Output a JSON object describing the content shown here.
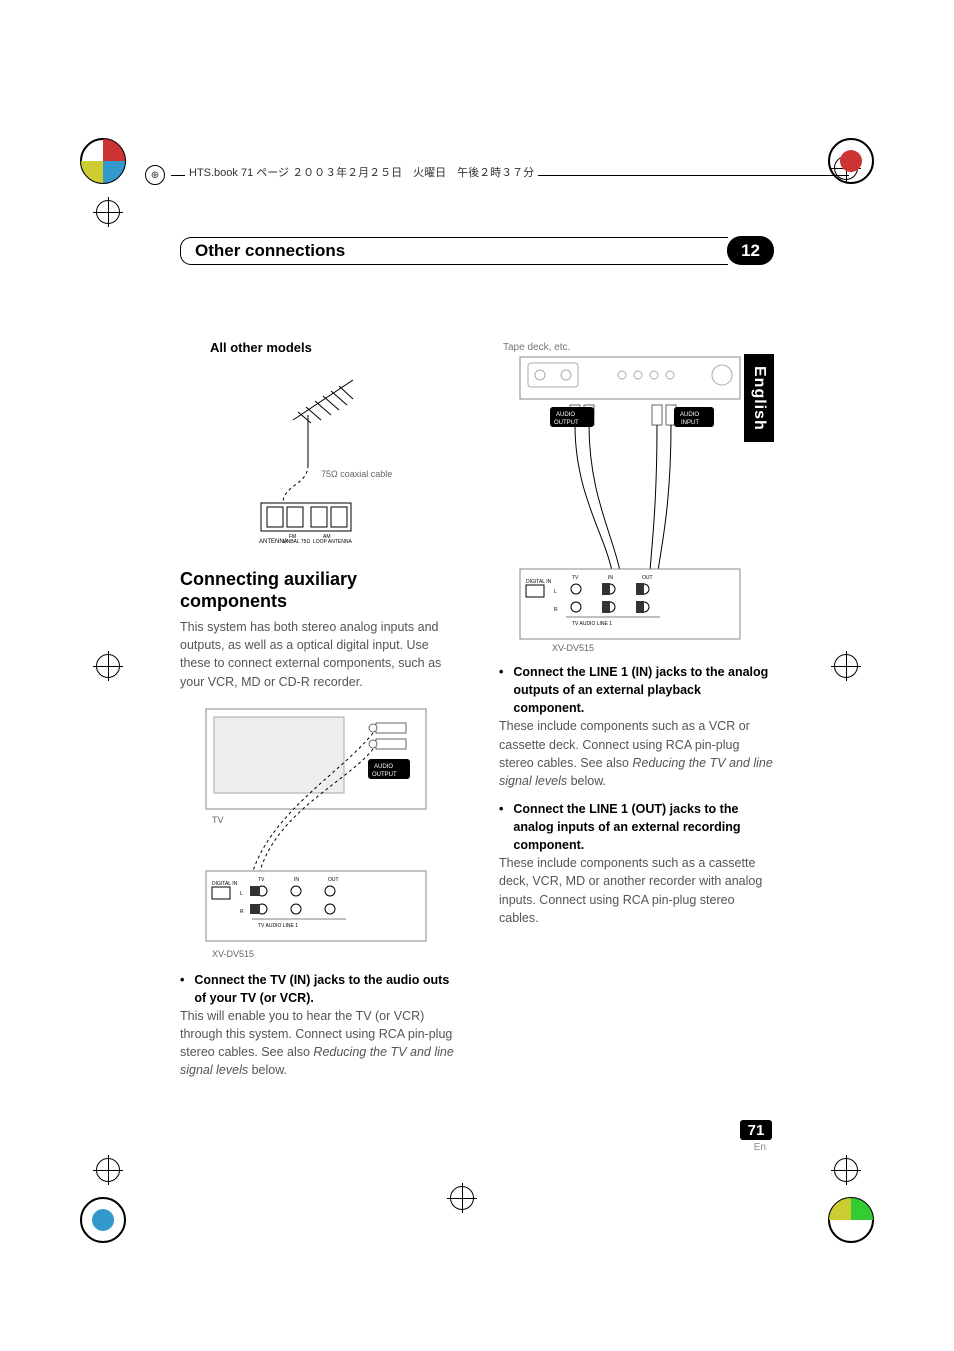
{
  "header": {
    "prepress": "HTS.book 71 ページ ２００３年２月２５日　火曜日　午後２時３７分"
  },
  "chapter": {
    "title": "Other connections",
    "number": "12"
  },
  "language_tab": "English",
  "page": {
    "number": "71",
    "lang": "En"
  },
  "left": {
    "sub_heading": "All other models",
    "cable_label": "75Ω coaxial cable",
    "antenna_block": "ANTENNA",
    "fm_label": "FM\nUNBAL 75Ω",
    "am_label": "AM\nLOOP ANTENNA",
    "section_heading": "Connecting auxiliary components",
    "section_body": "This system has both stereo analog inputs and outputs, as well as a optical digital input. Use these to connect external components, such as your VCR, MD or CD-R recorder.",
    "tv_label": "TV",
    "audio_output": "AUDIO\nOUTPUT",
    "xv": "XV-DV515",
    "bullet1_bold": "Connect the TV (IN) jacks to the audio outs of your TV (or VCR).",
    "bullet1_body": "This will enable you to hear the TV (or VCR) through this system. Connect using RCA pin-plug stereo cables. See also ",
    "bullet1_italic": "Reducing the TV and line signal levels",
    "bullet1_after": " below."
  },
  "right": {
    "tape_label": "Tape deck, etc.",
    "audio_output": "AUDIO\nOUTPUT",
    "audio_input": "AUDIO\nINPUT",
    "xv": "XV-DV515",
    "bullet1_bold": "Connect the LINE 1 (IN) jacks to the analog outputs of an external playback component.",
    "bullet1_body": "These include components such as a VCR or cassette deck. Connect using RCA pin-plug stereo cables. See also ",
    "bullet1_italic": "Reducing the TV and line signal levels",
    "bullet1_after": " below.",
    "bullet2_bold": "Connect the LINE 1 (OUT) jacks to the analog inputs of an external recording component.",
    "bullet2_body": "These include components such as a cassette deck, VCR, MD or another recorder with analog inputs. Connect using RCA pin-plug stereo cables."
  },
  "panel": {
    "digital_in": "DIGITAL IN",
    "tv": "TV",
    "in": "IN",
    "out": "OUT",
    "l": "L",
    "r": "R",
    "audio_line1": "TV    AUDIO  LINE 1"
  }
}
